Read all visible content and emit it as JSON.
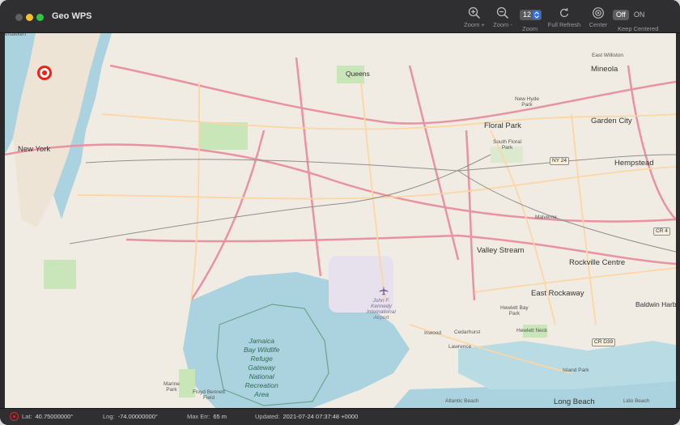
{
  "app": {
    "title": "Geo WPS"
  },
  "toolbar": {
    "zoom_in_label": "Zoom +",
    "zoom_out_label": "Zoom -",
    "zoom_label": "Zoom",
    "zoom_value": "12",
    "full_refresh_label": "Full Refresh",
    "center_label": "Center",
    "keep_centered_label": "Keep Centered",
    "keep_centered_off": "Off",
    "keep_centered_on": "ON"
  },
  "map": {
    "places": {
      "new_york": "New York",
      "queens": "Queens",
      "mineola": "Mineola",
      "east_williston": "East Williston",
      "new_hyde_park": "New Hyde\nPark",
      "floral_park": "Floral Park",
      "south_floral_park": "South Floral\nPark",
      "garden_city": "Garden City",
      "hempstead": "Hempstead",
      "malverne": "Malverne",
      "valley_stream": "Valley Stream",
      "rockville_centre": "Rockville Centre",
      "east_rockaway": "East Rockaway",
      "baldwin_harbor": "Baldwin Harbo",
      "hewlett_bay_park": "Hewlett Bay\nPark",
      "hewlett_neck": "Hewlett Neck",
      "inwood": "Inwood",
      "cedarhurst": "Cedarhurst",
      "lawrence": "Lawrence",
      "island_park": "Island Park",
      "long_beach": "Long Beach",
      "lido_beach": "Lido Beach",
      "atlantic_beach": "Atlantic Beach",
      "jfk_airport": "John F.\nKennedy\nInternational\nAirport",
      "jamaica_bay": "Jamaica\nBay Wildlife\nRefuge\nGateway\nNational\nRecreation\nArea",
      "floyd_bennett": "Floyd Bennett\nField",
      "marine_park": "Marine\nPark",
      "weehawken": "ehawken"
    },
    "shields": {
      "ny24": "NY 24",
      "cr4": "CR 4",
      "cr_d39": "CR D39"
    },
    "colors": {
      "land": "#f1ece3",
      "water": "#aad3df",
      "park": "#c8e6b7",
      "motorway": "#e892a2",
      "primary": "#fcd6a4",
      "rail": "#808080",
      "marker": "#e8231c"
    },
    "icons": {
      "location_marker": "location-target-icon",
      "airport": "airplane-icon"
    }
  },
  "status": {
    "lat_key": "Lat:",
    "lat_value": "40.75000000°",
    "lng_key": "Lng:",
    "lng_value": "-74.00000000°",
    "maxerr_key": "Max Err:",
    "maxerr_value": "65 m",
    "updated_key": "Updated:",
    "updated_value": "2021-07-24 07:37:48 +0000"
  }
}
